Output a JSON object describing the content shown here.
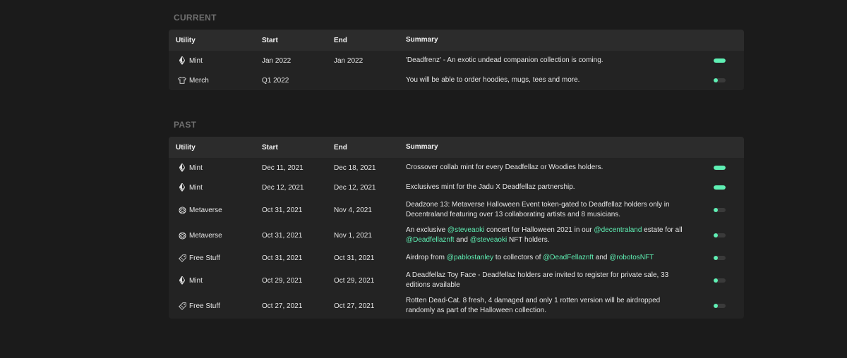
{
  "colors": {
    "accent": "#5ff0b4",
    "background": "#1b1b1b",
    "card": "#232323",
    "header": "#2c2c2c"
  },
  "sections": {
    "current": {
      "title": "CURRENT",
      "headers": {
        "utility": "Utility",
        "start": "Start",
        "end": "End",
        "summary": "Summary"
      },
      "rows": [
        {
          "icon": "ethereum-icon",
          "utility": "Mint",
          "start": "Jan 2022",
          "end": "Jan 2022",
          "summary": [
            {
              "t": "'Deadfrenz' - An exotic undead companion collection is coming."
            }
          ],
          "progress": 100
        },
        {
          "icon": "tshirt-icon",
          "utility": "Merch",
          "start": "Q1 2022",
          "end": "",
          "summary": [
            {
              "t": "You will be able to order hoodies, mugs, tees and more."
            }
          ],
          "progress": 35
        }
      ]
    },
    "past": {
      "title": "PAST",
      "headers": {
        "utility": "Utility",
        "start": "Start",
        "end": "End",
        "summary": "Summary"
      },
      "rows": [
        {
          "icon": "ethereum-icon",
          "utility": "Mint",
          "start": "Dec 11, 2021",
          "end": "Dec 18, 2021",
          "summary": [
            {
              "t": "Crossover collab mint for every Deadfellaz or Woodies holders."
            }
          ],
          "progress": 100
        },
        {
          "icon": "ethereum-icon",
          "utility": "Mint",
          "start": "Dec 12, 2021",
          "end": "Dec 12, 2021",
          "summary": [
            {
              "t": "Exclusives mint for the Jadu X Deadfellaz partnership."
            }
          ],
          "progress": 100
        },
        {
          "icon": "metaverse-icon",
          "utility": "Metaverse",
          "start": "Oct 31, 2021",
          "end": "Nov 4, 2021",
          "summary": [
            {
              "t": "Deadzone 13: Metaverse Halloween Event token-gated to Deadfellaz holders only in Decentraland featuring over 13 collaborating artists and 8 musicians."
            }
          ],
          "progress": 35
        },
        {
          "icon": "metaverse-icon",
          "utility": "Metaverse",
          "start": "Oct 31, 2021",
          "end": "Nov 1, 2021",
          "summary": [
            {
              "t": "An exclusive "
            },
            {
              "t": "@steveaoki",
              "link": true
            },
            {
              "t": " concert for Halloween 2021 in our "
            },
            {
              "t": "@decentraland",
              "link": true
            },
            {
              "t": " estate for all "
            },
            {
              "t": "@Deadfellaznft",
              "link": true
            },
            {
              "t": " and "
            },
            {
              "t": "@steveaoki",
              "link": true
            },
            {
              "t": " NFT holders."
            }
          ],
          "progress": 35
        },
        {
          "icon": "tag-icon",
          "utility": "Free Stuff",
          "start": "Oct 31, 2021",
          "end": "Oct 31, 2021",
          "summary": [
            {
              "t": "Airdrop from "
            },
            {
              "t": "@pablostanley",
              "link": true
            },
            {
              "t": " to collectors of "
            },
            {
              "t": "@DeadFellaznft",
              "link": true
            },
            {
              "t": " and "
            },
            {
              "t": "@robotosNFT",
              "link": true
            }
          ],
          "progress": 35
        },
        {
          "icon": "ethereum-icon",
          "utility": "Mint",
          "start": "Oct 29, 2021",
          "end": "Oct 29, 2021",
          "summary": [
            {
              "t": "A Deadfellaz Toy Face - Deadfellaz holders are invited to register for private sale, 33 editions available"
            }
          ],
          "progress": 35
        },
        {
          "icon": "tag-icon",
          "utility": "Free Stuff",
          "start": "Oct 27, 2021",
          "end": "Oct 27, 2021",
          "summary": [
            {
              "t": "Rotten Dead-Cat. 8 fresh, 4 damaged and only 1 rotten version will be airdropped randomly as part of the Halloween collection."
            }
          ],
          "progress": 35
        }
      ]
    }
  }
}
